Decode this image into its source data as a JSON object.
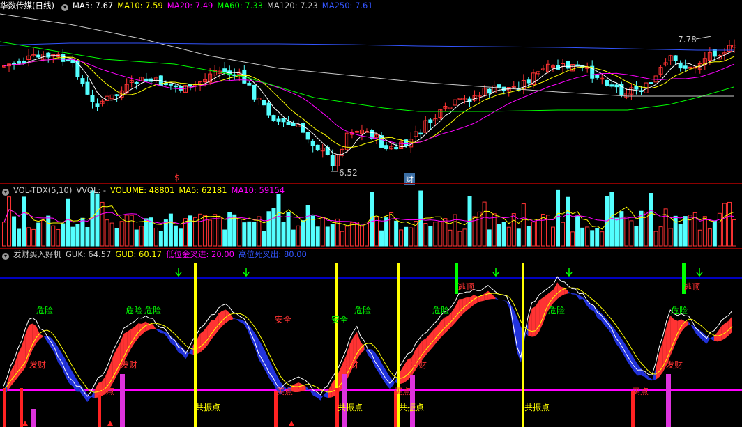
{
  "price_panel": {
    "stock_name": "华数传媒",
    "period": "(日线)",
    "indicators": [
      {
        "label": "MA5: 7.67",
        "color": "#ffffff"
      },
      {
        "label": "MA10: 7.59",
        "color": "#ffff00"
      },
      {
        "label": "MA20: 7.49",
        "color": "#ff00ff"
      },
      {
        "label": "MA60: 7.33",
        "color": "#00ff00"
      },
      {
        "label": "MA120: 7.23",
        "color": "#cccccc"
      },
      {
        "label": "MA250: 7.61",
        "color": "#3355ff"
      }
    ],
    "high_annotation": "7.78",
    "low_annotation": "6.52",
    "marker_dollar": "$",
    "marker_cai": "财"
  },
  "volume_panel": {
    "name": "VOL-TDX(5,10)",
    "indicators": [
      {
        "label": "VVOL: -",
        "color": "#cccccc"
      },
      {
        "label": "VOLUME: 48801",
        "color": "#ffff00"
      },
      {
        "label": "MA5: 62181",
        "color": "#ffff00"
      },
      {
        "label": "MA10: 59154",
        "color": "#ff00ff"
      }
    ]
  },
  "signal_panel": {
    "name": "发财买入好机",
    "indicators": [
      {
        "label": "GUK: 64.57",
        "color": "#cccccc"
      },
      {
        "label": "GUD: 60.17",
        "color": "#ffff00"
      },
      {
        "label": "低位金叉进: 20.00",
        "color": "#ff00ff"
      },
      {
        "label": "高位死叉出: 80.00",
        "color": "#3355ff"
      }
    ],
    "labels": {
      "danger": "危险",
      "safe": "安全",
      "get_rich": "发财",
      "buy_point": "买点",
      "resonance": "共振点",
      "escape_top": "逃顶"
    }
  },
  "colors": {
    "background": "#000000",
    "up": "#ff3333",
    "down": "#54ffff",
    "separator": "#8b0000"
  }
}
